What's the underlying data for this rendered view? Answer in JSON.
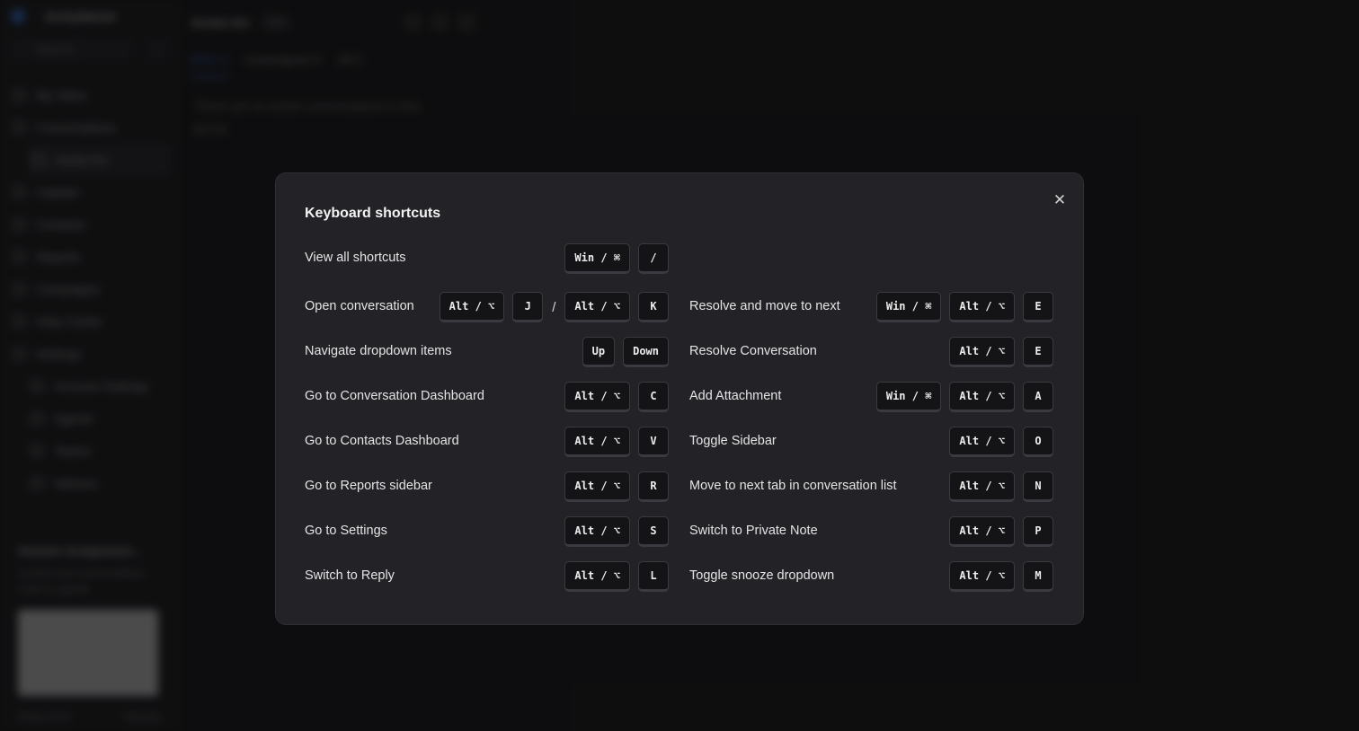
{
  "background": {
    "brand": "Acmydaone",
    "search_placeholder": "Search...",
    "nav": [
      {
        "label": "My Inbox"
      },
      {
        "label": "Conversations"
      },
      {
        "label": "Acme Inc",
        "sub": true,
        "active": true
      },
      {
        "label": "Captain"
      },
      {
        "label": "Contacts"
      },
      {
        "label": "Reports"
      },
      {
        "label": "Campaigns"
      },
      {
        "label": "Help Center"
      },
      {
        "label": "Settings"
      },
      {
        "label": "Account Settings",
        "sub": true
      },
      {
        "label": "Agents",
        "sub": true
      },
      {
        "label": "Teams",
        "sub": true
      },
      {
        "label": "Inboxes",
        "sub": true
      }
    ],
    "promo": {
      "title": "Smarter Assignment...",
      "body": "Control how conversations route to agents",
      "read_more": "Read more",
      "dismiss": "Dismiss"
    },
    "conversation": {
      "title": "Acme Inc",
      "badge": "Sort",
      "tabs": [
        "Mine 0",
        "Unassigned 0",
        "All 0"
      ],
      "empty_text": "There are no active conversations in this group."
    }
  },
  "modal": {
    "title": "Keyboard shortcuts",
    "close_icon": "close-icon",
    "shortcuts": [
      {
        "label": "View all shortcuts",
        "keys": [
          "Win / ⌘",
          "/"
        ]
      },
      {
        "label": "Open conversation",
        "keys": [
          "Alt / ⌥",
          "J",
          "/",
          "Alt / ⌥",
          "K"
        ]
      },
      {
        "label": "Resolve and move to next",
        "keys": [
          "Win / ⌘",
          "Alt / ⌥",
          "E"
        ]
      },
      {
        "label": "Navigate dropdown items",
        "keys": [
          "Up",
          "Down"
        ]
      },
      {
        "label": "Resolve Conversation",
        "keys": [
          "Alt / ⌥",
          "E"
        ]
      },
      {
        "label": "Go to Conversation Dashboard",
        "keys": [
          "Alt / ⌥",
          "C"
        ]
      },
      {
        "label": "Add Attachment",
        "keys": [
          "Win / ⌘",
          "Alt / ⌥",
          "A"
        ]
      },
      {
        "label": "Go to Contacts Dashboard",
        "keys": [
          "Alt / ⌥",
          "V"
        ]
      },
      {
        "label": "Toggle Sidebar",
        "keys": [
          "Alt / ⌥",
          "O"
        ]
      },
      {
        "label": "Go to Reports sidebar",
        "keys": [
          "Alt / ⌥",
          "R"
        ]
      },
      {
        "label": "Move to next tab in conversation list",
        "keys": [
          "Alt / ⌥",
          "N"
        ]
      },
      {
        "label": "Go to Settings",
        "keys": [
          "Alt / ⌥",
          "S"
        ]
      },
      {
        "label": "Switch to Private Note",
        "keys": [
          "Alt / ⌥",
          "P"
        ]
      },
      {
        "label": "Switch to Reply",
        "keys": [
          "Alt / ⌥",
          "L"
        ]
      },
      {
        "label": "Toggle snooze dropdown",
        "keys": [
          "Alt / ⌥",
          "M"
        ]
      }
    ]
  }
}
